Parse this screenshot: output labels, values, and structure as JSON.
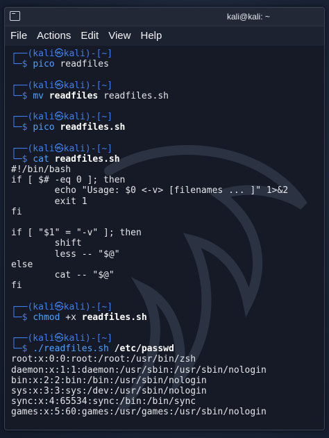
{
  "window": {
    "title": "kali@kali: ~"
  },
  "menu": [
    "File",
    "Actions",
    "Edit",
    "View",
    "Help"
  ],
  "prompt": {
    "top": "┌──(kali㉿kali)-[~]",
    "arrow": "└─$"
  },
  "blocks": [
    {
      "cmd": "pico",
      "args": "readfiles",
      "bold": ""
    },
    {
      "cmd": "mv",
      "bold": "readfiles",
      "args": "readfiles.sh"
    },
    {
      "cmd": "pico",
      "bold": "readfiles.sh",
      "args": ""
    },
    {
      "cmd": "cat",
      "bold": "readfiles.sh",
      "args": ""
    },
    {
      "cmd": "chmod",
      "args": "+x",
      "bold": "readfiles.sh"
    },
    {
      "cmd": "./readfiles.sh",
      "bold": "/etc/passwd",
      "args": ""
    }
  ],
  "script_output": [
    "#!/bin/bash",
    "if [ $# -eq 0 ]; then",
    "        echo \"Usage: $0 <-v> [filenames ... ]\" 1>&2",
    "        exit 1",
    "fi",
    "",
    "if [ \"$1\" = \"-v\" ]; then",
    "        shift",
    "        less -- \"$@\"",
    "else",
    "        cat -- \"$@\"",
    "fi"
  ],
  "passwd_output": [
    "root:x:0:0:root:/root:/usr/bin/zsh",
    "daemon:x:1:1:daemon:/usr/sbin:/usr/sbin/nologin",
    "bin:x:2:2:bin:/bin:/usr/sbin/nologin",
    "sys:x:3:3:sys:/dev:/usr/sbin/nologin",
    "sync:x:4:65534:sync:/bin:/bin/sync",
    "games:x:5:60:games:/usr/games:/usr/sbin/nologin"
  ]
}
